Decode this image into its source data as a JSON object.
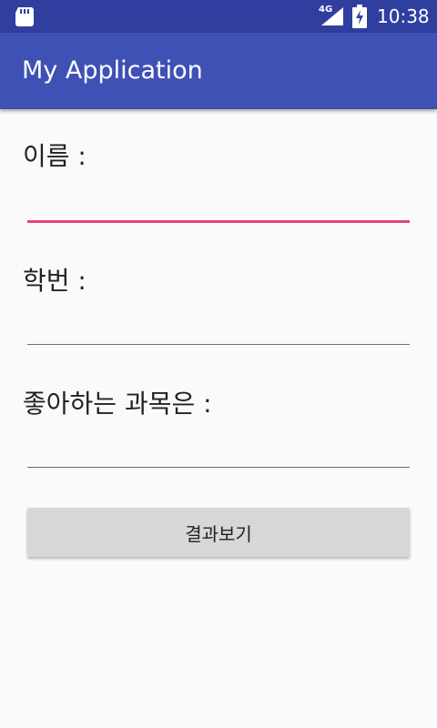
{
  "status_bar": {
    "network_type": "4G",
    "time": "10:38",
    "icons": [
      "sd-card-icon",
      "signal-icon",
      "battery-charging-icon"
    ]
  },
  "app_bar": {
    "title": "My Application"
  },
  "form": {
    "name_label": "이름 :",
    "name_value": "",
    "student_id_label": "학번 :",
    "student_id_value": "",
    "subject_label": "좋아하는 과목은 :",
    "subject_value": "",
    "result_button_label": "결과보기"
  },
  "colors": {
    "status_bar": "#303f9f",
    "app_bar": "#3f51b5",
    "focus_underline": "#e54380",
    "button": "#d6d7d7"
  }
}
